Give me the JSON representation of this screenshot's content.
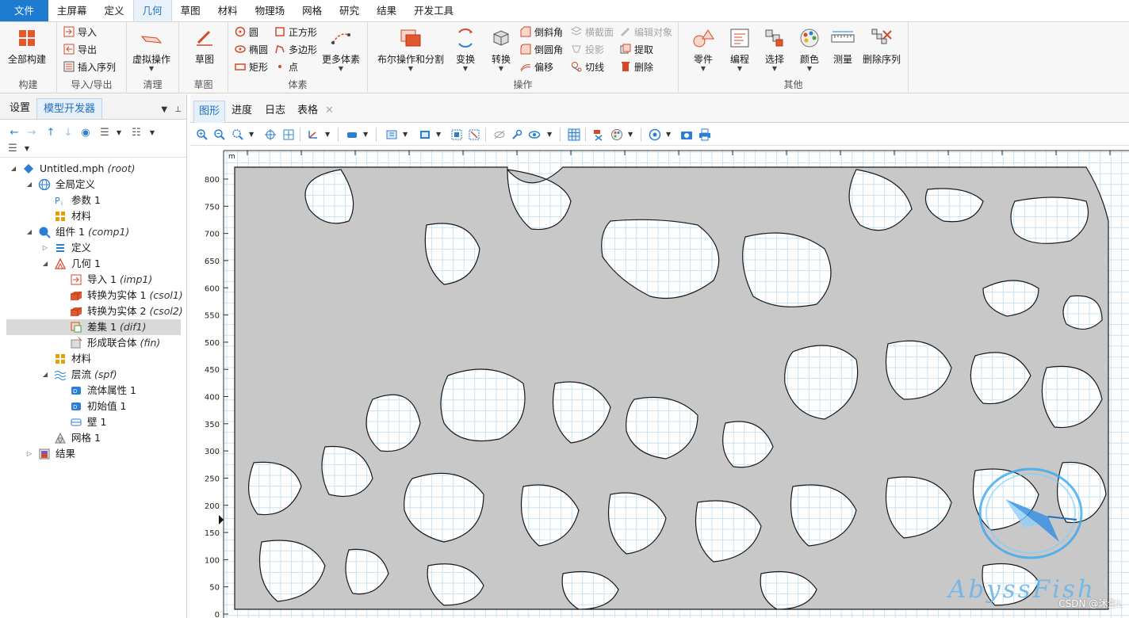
{
  "menu": {
    "items": [
      "文件",
      "主屏幕",
      "定义",
      "几何",
      "草图",
      "材料",
      "物理场",
      "网格",
      "研究",
      "结果",
      "开发工具"
    ],
    "active": "几何"
  },
  "ribbon": {
    "build": {
      "all_build": "全部构建",
      "group": "构建"
    },
    "import": {
      "import": "导入",
      "export": "导出",
      "insert_sequence": "插入序列",
      "group": "导入/导出"
    },
    "cleanup": {
      "virtual_ops": "虚拟操作",
      "group": "清理"
    },
    "sketch": {
      "sketch": "草图",
      "group": "草图"
    },
    "primitives": {
      "circle": "圆",
      "ellipse": "椭圆",
      "rectangle": "矩形",
      "square": "正方形",
      "polygon": "多边形",
      "point": "点",
      "more": "更多体素",
      "group": "体素"
    },
    "operations": {
      "boolean": "布尔操作和分割",
      "transform": "变换",
      "convert": "转换",
      "chamfer": "倒斜角",
      "fillet": "倒圆角",
      "offset": "偏移",
      "cross_section": "横截面",
      "projection": "投影",
      "tangent": "切线",
      "edit_object": "编辑对象",
      "extract": "提取",
      "delete": "删除",
      "group": "操作"
    },
    "other": {
      "parts": "零件",
      "programming": "编程",
      "select": "选择",
      "color": "颜色",
      "measure": "测量",
      "delete_sequence": "删除序列",
      "group": "其他"
    }
  },
  "left_panel": {
    "tabs": [
      "设置",
      "模型开发器"
    ],
    "active_tab": "模型开发器",
    "tree": [
      {
        "label": "Untitled.mph",
        "tag": "(root)",
        "level": 0,
        "icon": "model-icon",
        "expanded": true
      },
      {
        "label": "全局定义",
        "tag": "",
        "level": 1,
        "icon": "globe-icon",
        "expanded": true
      },
      {
        "label": "参数 1",
        "tag": "",
        "level": 2,
        "icon": "parameter-icon"
      },
      {
        "label": "材料",
        "tag": "",
        "level": 2,
        "icon": "material-icon"
      },
      {
        "label": "组件 1",
        "tag": "(comp1)",
        "level": 1,
        "icon": "component-icon",
        "expanded": true
      },
      {
        "label": "定义",
        "tag": "",
        "level": 2,
        "icon": "definitions-icon",
        "collapsed": true
      },
      {
        "label": "几何 1",
        "tag": "",
        "level": 2,
        "icon": "geometry-icon",
        "expanded": true
      },
      {
        "label": "导入 1",
        "tag": "(imp1)",
        "level": 3,
        "icon": "import-icon"
      },
      {
        "label": "转换为实体 1",
        "tag": "(csol1)",
        "level": 3,
        "icon": "convert-solid-icon"
      },
      {
        "label": "转换为实体 2",
        "tag": "(csol2)",
        "level": 3,
        "icon": "convert-solid-icon"
      },
      {
        "label": "差集 1",
        "tag": "(dif1)",
        "level": 3,
        "icon": "difference-icon",
        "selected": true
      },
      {
        "label": "形成联合体",
        "tag": "(fin)",
        "level": 3,
        "icon": "form-union-icon"
      },
      {
        "label": "材料",
        "tag": "",
        "level": 2,
        "icon": "material-icon"
      },
      {
        "label": "层流",
        "tag": "(spf)",
        "level": 2,
        "icon": "laminar-flow-icon",
        "expanded": true
      },
      {
        "label": "流体属性 1",
        "tag": "",
        "level": 3,
        "icon": "fluid-properties-icon"
      },
      {
        "label": "初始值 1",
        "tag": "",
        "level": 3,
        "icon": "initial-values-icon"
      },
      {
        "label": "壁 1",
        "tag": "",
        "level": 3,
        "icon": "wall-icon"
      },
      {
        "label": "网格 1",
        "tag": "",
        "level": 2,
        "icon": "mesh-icon"
      },
      {
        "label": "结果",
        "tag": "",
        "level": 1,
        "icon": "results-icon",
        "collapsed": true
      }
    ]
  },
  "graphics": {
    "tabs": [
      "图形",
      "进度",
      "日志",
      "表格"
    ],
    "active_tab": "图形",
    "unit": "m",
    "y_ticks": [
      "800",
      "750",
      "700",
      "650",
      "600",
      "550",
      "500",
      "450",
      "400",
      "350",
      "300",
      "250",
      "200",
      "150",
      "100",
      "50",
      "0"
    ],
    "grid_color": "#c9e3f1",
    "geometry_fill": "#c8c8c8"
  },
  "watermark": {
    "text": "AbyssFish",
    "credit": "CSDN @沭生L"
  }
}
